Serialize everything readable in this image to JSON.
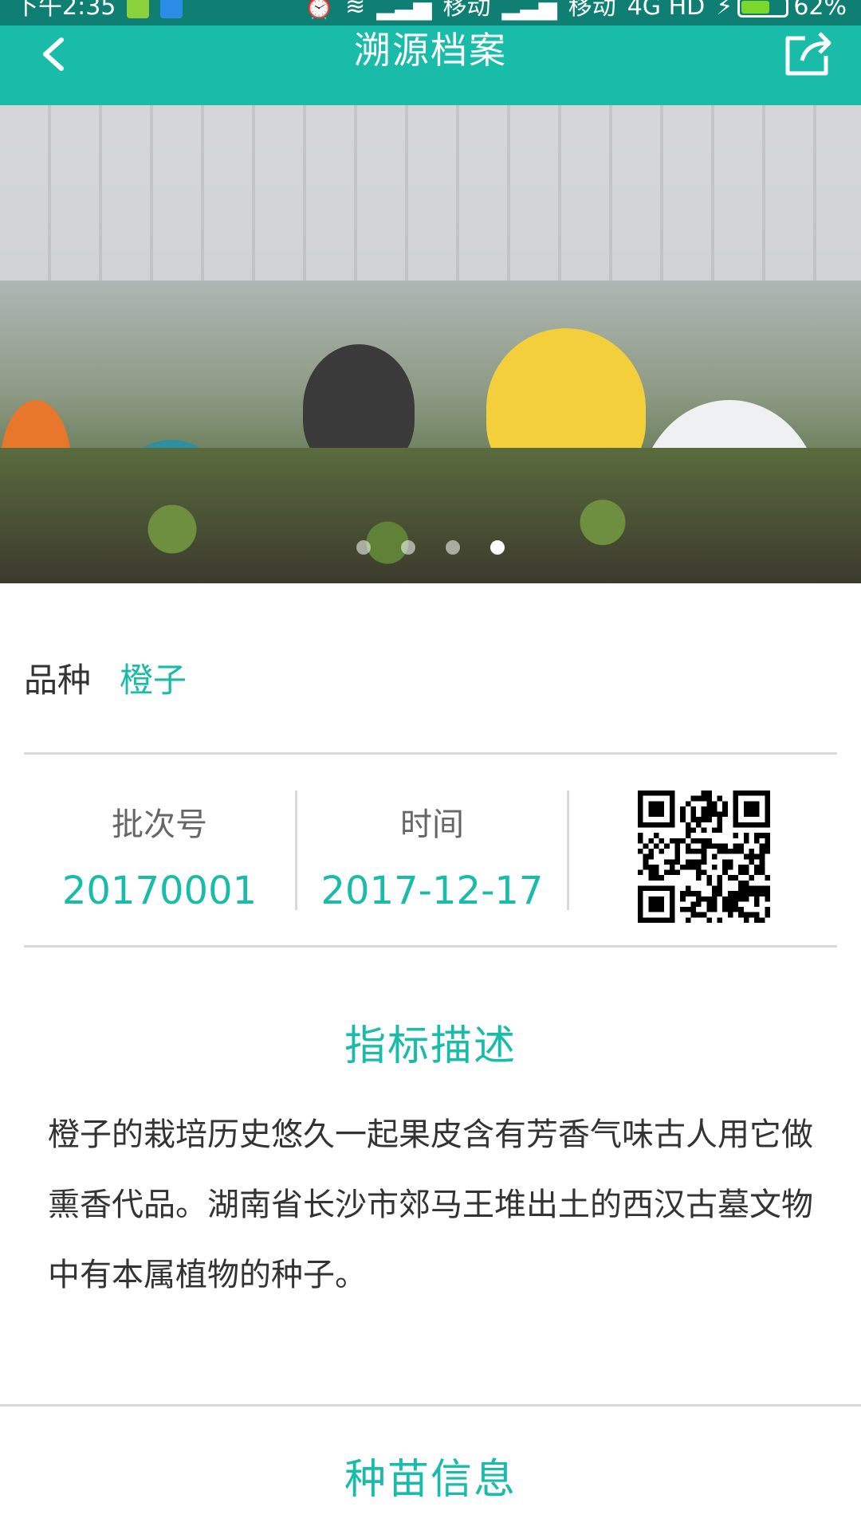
{
  "status_bar": {
    "time": "下午2:35",
    "carrier1": "移动",
    "carrier2": "移动",
    "network": "4G HD",
    "battery": "62%",
    "battery_level": 0.62
  },
  "header": {
    "title": "溯源档案",
    "back_icon": "chevron-left-icon",
    "share_icon": "share-icon"
  },
  "banner": {
    "slide_count": 4,
    "active_index": 3
  },
  "variety": {
    "label": "品种",
    "value": "橙子"
  },
  "batch": {
    "label": "批次号",
    "value": "20170001"
  },
  "time": {
    "label": "时间",
    "value": "2017-12-17"
  },
  "indicator": {
    "title": "指标描述",
    "text": "橙子的栽培历史悠久一起果皮含有芳香气味古人用它做熏香代品。湖南省长沙市郊马王堆出土的西汉古墓文物中有本属植物的种子。"
  },
  "seedling": {
    "title": "种苗信息"
  },
  "colors": {
    "accent": "#18bca8",
    "status_bar": "#0f7f73"
  }
}
